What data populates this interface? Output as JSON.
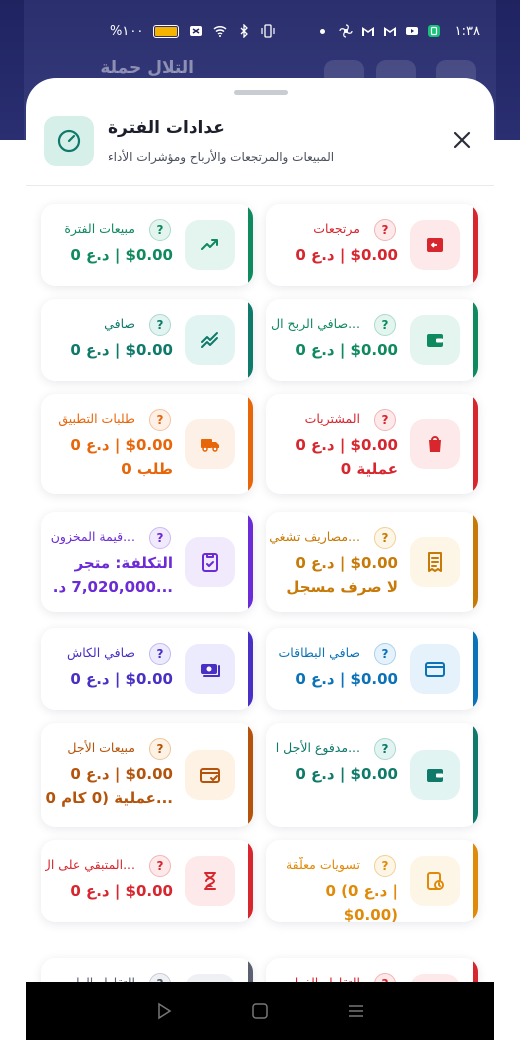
{
  "status_bar": {
    "battery_text": "%١٠٠",
    "time": "١:٣٨"
  },
  "background": {
    "title": "التلال حملة"
  },
  "sheet": {
    "title": "عدادات الفترة",
    "subtitle": "المبيعات والمرتجعات والأرباح ومؤشرات الأداء",
    "icons": {
      "header": "gauge-icon",
      "close": "close-icon"
    }
  },
  "cards": [
    {
      "title": "مرتجعات",
      "line1": "$0.00 | د.ع 0",
      "line2": "",
      "icon": "return-icon",
      "color": "#d7262e",
      "qcolor": "#f3b4b6",
      "bg": "#fde9e9"
    },
    {
      "title": "مبيعات الفترة",
      "line1": "$0.00 | د.ع 0",
      "line2": "",
      "icon": "trend-up-icon",
      "color": "#0f8a5f",
      "qcolor": "#a9dcc6",
      "bg": "#e3f5ee"
    },
    {
      "title": "...صافي الربح ال",
      "line1": "$0.00 | د.ع 0",
      "line2": "",
      "icon": "wallet-icon",
      "color": "#0f8a5f",
      "qcolor": "#a9dcc6",
      "bg": "#e3f5ee"
    },
    {
      "title": "صافي",
      "line1": "$0.00 | د.ع 0",
      "line2": "",
      "icon": "trend-double-icon",
      "color": "#0f7a6a",
      "qcolor": "#a9d8d0",
      "bg": "#e2f4f1"
    },
    {
      "title": "المشتريات",
      "line1": "$0.00 | د.ع 0",
      "line2": "عملية 0",
      "icon": "shopping-bag-icon",
      "color": "#d7262e",
      "qcolor": "#f3b4b6",
      "bg": "#fde9e9"
    },
    {
      "title": "طلبات التطبيق",
      "line1": "$0.00 | د.ع 0",
      "line2": "طلب 0",
      "icon": "truck-icon",
      "color": "#e8660a",
      "qcolor": "#f6c29f",
      "bg": "#fdf0e6"
    },
    {
      "title": "...مصاريف تشغي",
      "line1": "$0.00 | د.ع 0",
      "line2": "لا صرف مسجل",
      "icon": "receipt-icon",
      "color": "#c77a08",
      "qcolor": "#efd199",
      "bg": "#fdf6e7"
    },
    {
      "title": "...قيمة المخزون",
      "line1": "التكلفة: متجر",
      "line2": "...7,020,000 د.",
      "icon": "clipboard-check-icon",
      "color": "#6b2bd6",
      "qcolor": "#cdb8f0",
      "bg": "#f0eafc"
    },
    {
      "title": "صافي البطاقات",
      "line1": "$0.00 | د.ع 0",
      "line2": "",
      "icon": "card-icon",
      "color": "#0b72b8",
      "qcolor": "#a8d0ec",
      "bg": "#e6f2fb"
    },
    {
      "title": "صافي الكاش",
      "line1": "$0.00 | د.ع 0",
      "line2": "",
      "icon": "cash-icon",
      "color": "#4a2fc4",
      "qcolor": "#c3b8ee",
      "bg": "#eceafd"
    },
    {
      "title": "...مدفوع الأجل ا",
      "line1": "$0.00 | د.ع 0",
      "line2": "",
      "icon": "wallet-icon",
      "color": "#0f7a6a",
      "qcolor": "#a9d8d0",
      "bg": "#e2f4f1"
    },
    {
      "title": "مبيعات الأجل",
      "line1": "$0.00 | د.ع 0",
      "line2": "...عملية (0 كام 0",
      "icon": "card-check-icon",
      "color": "#b4540c",
      "qcolor": "#ecc59c",
      "bg": "#fdf2e3"
    },
    {
      "title": "تسويات معلّقة",
      "line1": "| د.ع 0) 0",
      "line2": "($0.00",
      "icon": "clipboard-clock-icon",
      "color": "#e08a0a",
      "qcolor": "#f2cf95",
      "bg": "#fdf5e6"
    },
    {
      "title": "...المتبقي على ال",
      "line1": "$0.00 | د.ع 0",
      "line2": "",
      "icon": "hourglass-icon",
      "color": "#d7262e",
      "qcolor": "#f3b4b6",
      "bg": "#fde9e9"
    },
    {
      "title": "التقاطع الفعلي",
      "line1": "",
      "line2": "",
      "icon": "generic-icon",
      "color": "#d7262e",
      "qcolor": "#f3b4b6",
      "bg": "#fde9e9"
    },
    {
      "title": "التقاطع العام",
      "line1": "",
      "line2": "",
      "icon": "generic-icon",
      "color": "#5a6070",
      "qcolor": "#c9ccd3",
      "bg": "#eef0f3"
    }
  ],
  "nav": {
    "back": "back-icon",
    "home": "home-icon",
    "menu": "menu-icon"
  }
}
